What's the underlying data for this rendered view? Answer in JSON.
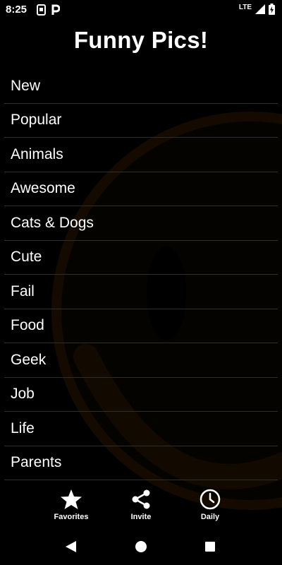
{
  "status_bar": {
    "time": "8:25",
    "network": "LTE"
  },
  "header": {
    "title": "Funny Pics!"
  },
  "categories": [
    {
      "label": "New"
    },
    {
      "label": "Popular"
    },
    {
      "label": "Animals"
    },
    {
      "label": "Awesome"
    },
    {
      "label": "Cats & Dogs"
    },
    {
      "label": "Cute"
    },
    {
      "label": "Fail"
    },
    {
      "label": "Food"
    },
    {
      "label": "Geek"
    },
    {
      "label": "Job"
    },
    {
      "label": "Life"
    },
    {
      "label": "Parents"
    }
  ],
  "bottom_nav": {
    "favorites": {
      "label": "Favorites",
      "icon": "star-icon"
    },
    "invite": {
      "label": "Invite",
      "icon": "share-icon"
    },
    "daily": {
      "label": "Daily",
      "icon": "clock-icon"
    }
  },
  "system_nav": {
    "back_icon": "back-triangle-icon",
    "home_icon": "home-circle-icon",
    "recents_icon": "recents-square-icon"
  },
  "colors": {
    "background": "#000000",
    "text": "#ffffff",
    "divider": "#2e2e2e",
    "background_smiley": "#1a0e00"
  }
}
